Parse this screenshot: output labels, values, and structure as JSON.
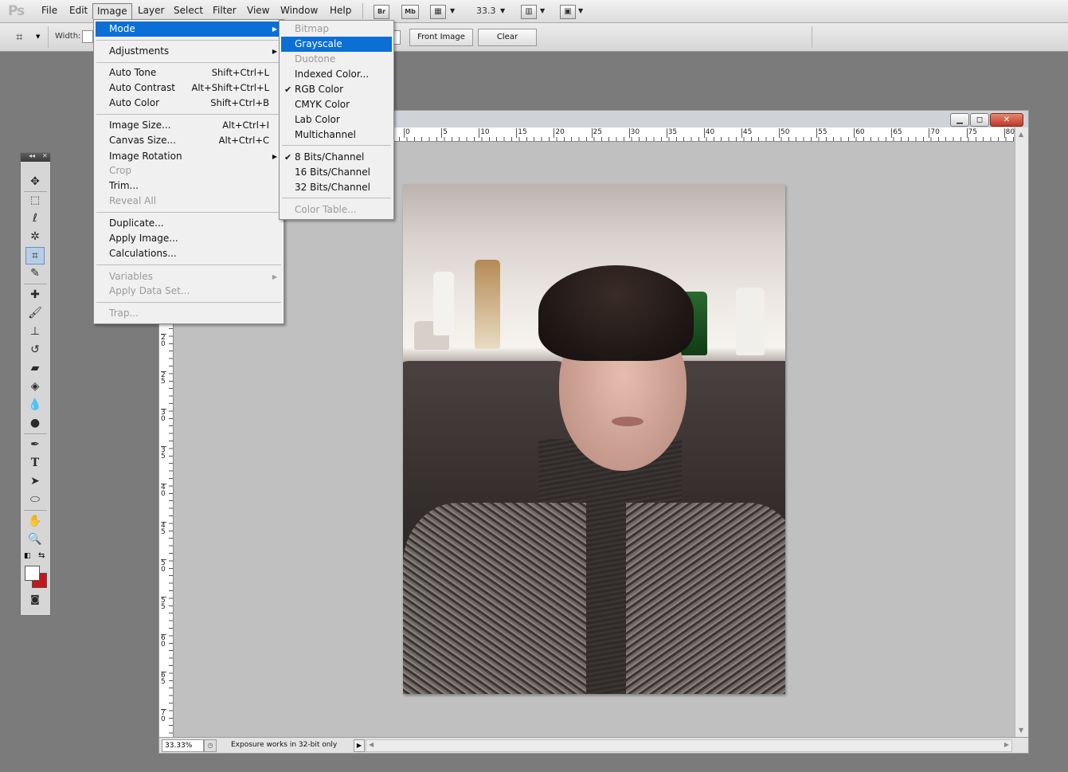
{
  "menubar": {
    "logo": "Ps",
    "items": [
      "File",
      "Edit",
      "Image",
      "Layer",
      "Select",
      "Filter",
      "View",
      "Window",
      "Help"
    ],
    "bridge_label": "Br",
    "minibridge_label": "Mb",
    "zoom": "33.3"
  },
  "options": {
    "width_label": "Width:",
    "front_image": "Front Image",
    "clear": "Clear"
  },
  "image_menu": {
    "mode": "Mode",
    "adjustments": "Adjustments",
    "auto_tone": {
      "label": "Auto Tone",
      "shortcut": "Shift+Ctrl+L"
    },
    "auto_contrast": {
      "label": "Auto Contrast",
      "shortcut": "Alt+Shift+Ctrl+L"
    },
    "auto_color": {
      "label": "Auto Color",
      "shortcut": "Shift+Ctrl+B"
    },
    "image_size": {
      "label": "Image Size...",
      "shortcut": "Alt+Ctrl+I"
    },
    "canvas_size": {
      "label": "Canvas Size...",
      "shortcut": "Alt+Ctrl+C"
    },
    "image_rotation": "Image Rotation",
    "crop": "Crop",
    "trim": "Trim...",
    "reveal_all": "Reveal All",
    "duplicate": "Duplicate...",
    "apply_image": "Apply Image...",
    "calculations": "Calculations...",
    "variables": "Variables",
    "apply_data_set": "Apply Data Set...",
    "trap": "Trap..."
  },
  "mode_menu": {
    "bitmap": "Bitmap",
    "grayscale": "Grayscale",
    "duotone": "Duotone",
    "indexed_color": "Indexed Color...",
    "rgb_color": "RGB Color",
    "cmyk_color": "CMYK Color",
    "lab_color": "Lab Color",
    "multichannel": "Multichannel",
    "bits8": "8 Bits/Channel",
    "bits16": "16 Bits/Channel",
    "bits32": "32 Bits/Channel",
    "color_table": "Color Table...",
    "checkmark": "✔"
  },
  "ruler": {
    "h_ticks": [
      "0",
      "5",
      "10",
      "15",
      "20",
      "25",
      "30",
      "35",
      "40",
      "45",
      "50",
      "55",
      "60",
      "65",
      "70",
      "75",
      "80"
    ],
    "v_ticks": [
      "2\n0",
      "2\n5",
      "3\n0",
      "3\n5",
      "4\n0",
      "4\n5",
      "5\n0",
      "5\n5",
      "6\n0",
      "6\n5",
      "7\n0"
    ]
  },
  "status": {
    "zoom": "33.33%",
    "text": "Exposure works in 32-bit only"
  },
  "colors": {
    "menu_highlight": "#0b6fd6",
    "foreground_swatch": "#ffffff",
    "background_swatch": "#c4161c"
  }
}
